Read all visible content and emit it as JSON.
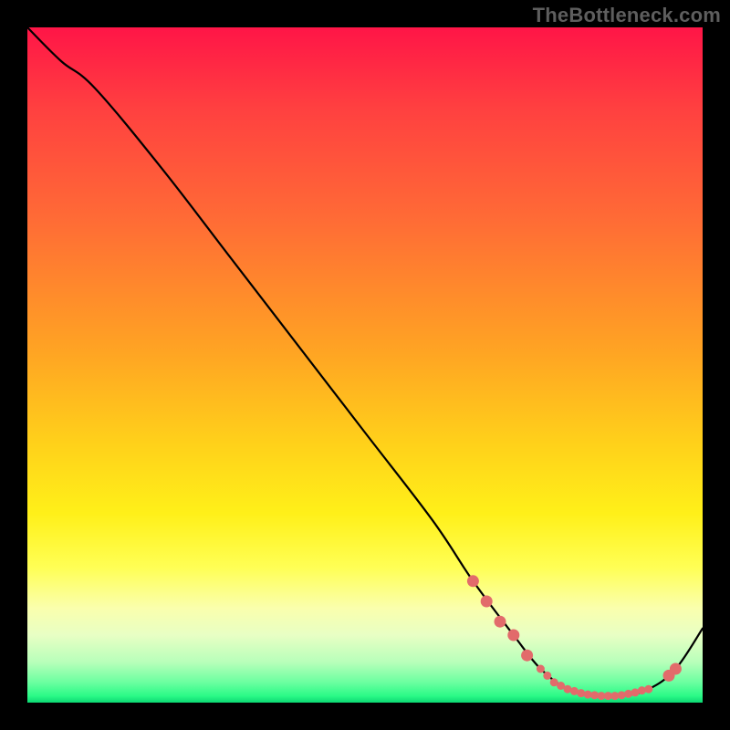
{
  "watermark": "TheBottleneck.com",
  "chart_data": {
    "type": "line",
    "title": "",
    "xlabel": "",
    "ylabel": "",
    "xlim": [
      0,
      100
    ],
    "ylim": [
      0,
      100
    ],
    "grid": false,
    "legend": false,
    "series": [
      {
        "name": "bottleneck-curve",
        "x": [
          0,
          5,
          10,
          20,
          30,
          40,
          50,
          60,
          66,
          72,
          76,
          80,
          84,
          88,
          92,
          96,
          100
        ],
        "y": [
          100,
          95,
          91,
          79,
          66,
          53,
          40,
          27,
          18,
          10,
          5,
          2,
          1,
          1,
          2,
          5,
          11
        ],
        "color": "#000000"
      }
    ],
    "markers": {
      "name": "highlighted-points",
      "color": "#e26b6b",
      "radius_small": 4.5,
      "radius_large": 6.5,
      "points": [
        {
          "x": 66,
          "y": 18,
          "r": "large"
        },
        {
          "x": 68,
          "y": 15,
          "r": "large"
        },
        {
          "x": 70,
          "y": 12,
          "r": "large"
        },
        {
          "x": 72,
          "y": 10,
          "r": "large"
        },
        {
          "x": 74,
          "y": 7,
          "r": "large"
        },
        {
          "x": 76,
          "y": 5,
          "r": "small"
        },
        {
          "x": 77,
          "y": 4,
          "r": "small"
        },
        {
          "x": 78,
          "y": 3,
          "r": "small"
        },
        {
          "x": 79,
          "y": 2.5,
          "r": "small"
        },
        {
          "x": 80,
          "y": 2,
          "r": "small"
        },
        {
          "x": 81,
          "y": 1.7,
          "r": "small"
        },
        {
          "x": 82,
          "y": 1.4,
          "r": "small"
        },
        {
          "x": 83,
          "y": 1.2,
          "r": "small"
        },
        {
          "x": 84,
          "y": 1.1,
          "r": "small"
        },
        {
          "x": 85,
          "y": 1.0,
          "r": "small"
        },
        {
          "x": 86,
          "y": 1.0,
          "r": "small"
        },
        {
          "x": 87,
          "y": 1.0,
          "r": "small"
        },
        {
          "x": 88,
          "y": 1.1,
          "r": "small"
        },
        {
          "x": 89,
          "y": 1.3,
          "r": "small"
        },
        {
          "x": 90,
          "y": 1.5,
          "r": "small"
        },
        {
          "x": 91,
          "y": 1.8,
          "r": "small"
        },
        {
          "x": 92,
          "y": 2.0,
          "r": "small"
        },
        {
          "x": 95,
          "y": 4.0,
          "r": "large"
        },
        {
          "x": 96,
          "y": 5.0,
          "r": "large"
        }
      ]
    }
  }
}
